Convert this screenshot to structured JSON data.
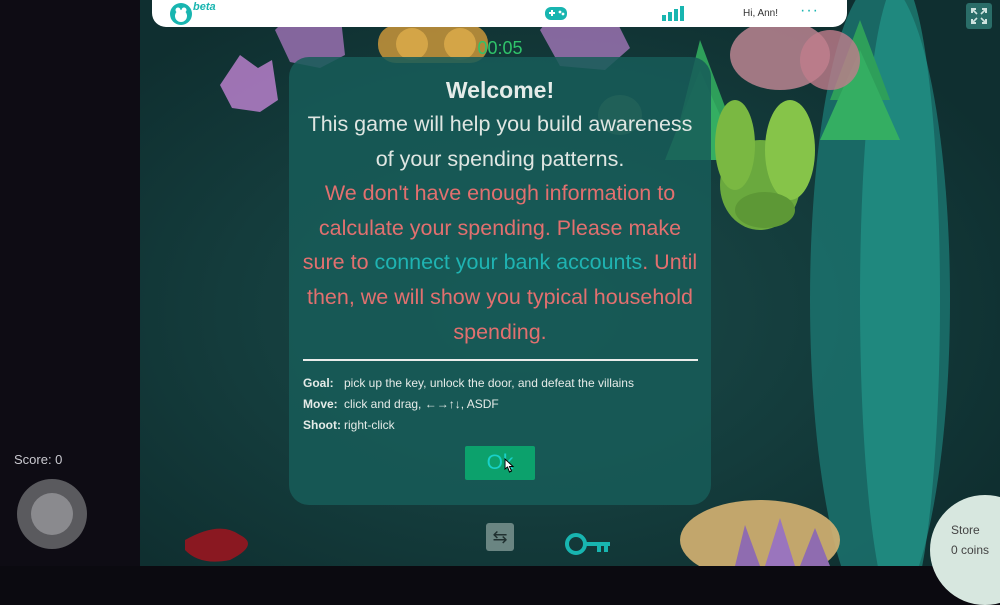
{
  "header": {
    "beta_label": "beta",
    "greeting": "Hi, Ann!",
    "more_label": "···",
    "icons": [
      "app-logo-icon",
      "gamepad-icon",
      "bar-chart-icon",
      "more-icon",
      "fullscreen-icon"
    ]
  },
  "game": {
    "timer": "00:05",
    "score_label": "Score: 0",
    "store_label": "Store",
    "coins_label": "0 coins"
  },
  "modal": {
    "title": "Welcome!",
    "intro": "This game will help you build awareness of your spending patterns.",
    "warning_prefix": "We don't have enough information to calculate your spending. Please make sure to ",
    "link_text": "connect your bank accounts",
    "warning_suffix": ". Until then, we will show you typical household spending.",
    "goal_key": "Goal:",
    "goal_value": "pick up the key, unlock the door, and defeat the villains",
    "move_key": "Move:",
    "move_value": "click and drag, ←→↑↓, ASDF",
    "shoot_key": "Shoot:",
    "shoot_value": "right-click",
    "ok_label": "Ok"
  },
  "colors": {
    "accent": "#18b5b0",
    "warning": "#e2706f",
    "ok_button": "#0ca16c",
    "timer": "#2fc36a"
  }
}
